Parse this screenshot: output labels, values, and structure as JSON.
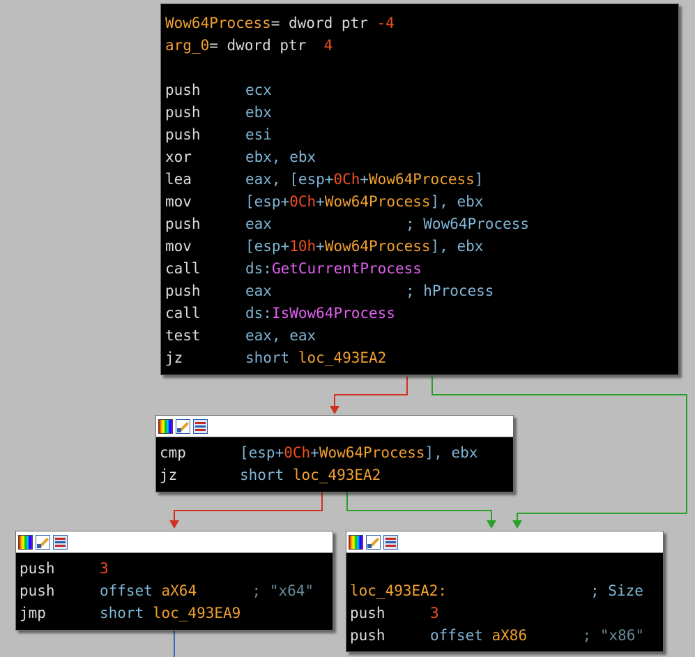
{
  "colors": {
    "background": "#bdbdbd",
    "edge_true": "#2aa02a",
    "edge_false": "#d03020",
    "edge_plain": "#3a6ab0"
  },
  "block1": {
    "var_lines": [
      {
        "name": "Wow64Process",
        "rest": "= dword ptr ",
        "val": "-4"
      },
      {
        "name": "arg_0",
        "rest": "= dword ptr  ",
        "val": "4"
      }
    ],
    "instructions": [
      {
        "mn": "push",
        "op": "ecx"
      },
      {
        "mn": "push",
        "op": "ebx"
      },
      {
        "mn": "push",
        "op": "esi"
      },
      {
        "mn": "xor",
        "op": "ebx, ebx"
      },
      {
        "mn": "lea",
        "op1": "eax, [esp+",
        "num": "0Ch",
        "plus": "+",
        "var": "Wow64Process",
        "end": "]"
      },
      {
        "mn": "mov",
        "op1": "[esp+",
        "num": "0Ch",
        "plus": "+",
        "var": "Wow64Process",
        "end": "], ebx"
      },
      {
        "mn": "push",
        "op": "eax",
        "comment": "; Wow64Process"
      },
      {
        "mn": "mov",
        "op1": "[esp+",
        "num": "10h",
        "plus": "+",
        "var": "Wow64Process",
        "end": "], ebx"
      },
      {
        "mn": "call",
        "prefix": "ds:",
        "func": "GetCurrentProcess"
      },
      {
        "mn": "push",
        "op": "eax",
        "comment": "; hProcess"
      },
      {
        "mn": "call",
        "prefix": "ds:",
        "func": "IsWow64Process"
      },
      {
        "mn": "test",
        "op": "eax, eax"
      },
      {
        "mn": "jz",
        "short": "short ",
        "label": "loc_493EA2"
      }
    ]
  },
  "block2": {
    "cmp": {
      "mn": "cmp",
      "op1": "[esp+",
      "num": "0Ch",
      "plus": "+",
      "var": "Wow64Process",
      "end": "], ebx"
    },
    "jz": {
      "mn": "jz",
      "short": "short ",
      "label": "loc_493EA2"
    }
  },
  "block3": {
    "l1": {
      "mn": "push",
      "num": "3"
    },
    "l2": {
      "mn": "push",
      "op": "offset ",
      "label": "aX64",
      "comment": ";",
      "str": " \"x64\""
    },
    "l3": {
      "mn": "jmp",
      "short": "short ",
      "label": "loc_493EA9"
    }
  },
  "block4": {
    "loc": {
      "label": "loc_493EA2:",
      "comment": "; Size"
    },
    "l1": {
      "mn": "push",
      "num": "3"
    },
    "l2": {
      "mn": "push",
      "op": "offset ",
      "label": "aX86",
      "comment": ";",
      "str": " \"x86\""
    }
  },
  "icons": [
    "palette-icon",
    "edit-icon",
    "graph-icon"
  ]
}
